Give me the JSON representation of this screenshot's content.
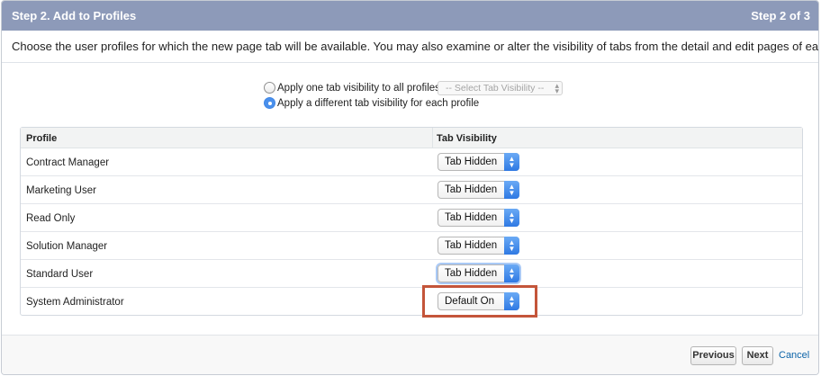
{
  "header": {
    "title": "Step 2. Add to Profiles",
    "step": "Step 2 of 3"
  },
  "intro": "Choose the user profiles for which the new page tab will be available. You may also examine or alter the visibility of tabs from the detail and edit pages of each profile.",
  "visibility_mode": {
    "option_all": {
      "label": "Apply one tab visibility to all profiles",
      "checked": false
    },
    "all_select_placeholder": "-- Select Tab Visibility --",
    "option_each": {
      "label": "Apply a different tab visibility for each profile",
      "checked": true
    }
  },
  "table": {
    "headers": {
      "profile": "Profile",
      "visibility": "Tab Visibility"
    },
    "rows": [
      {
        "profile": "Contract Manager",
        "visibility": "Tab Hidden"
      },
      {
        "profile": "Marketing User",
        "visibility": "Tab Hidden"
      },
      {
        "profile": "Read Only",
        "visibility": "Tab Hidden"
      },
      {
        "profile": "Solution Manager",
        "visibility": "Tab Hidden"
      },
      {
        "profile": "Standard User",
        "visibility": "Tab Hidden"
      },
      {
        "profile": "System Administrator",
        "visibility": "Default On"
      }
    ]
  },
  "footer": {
    "previous": "Previous",
    "next": "Next",
    "cancel": "Cancel"
  },
  "colors": {
    "header_bg": "#8d9ab9",
    "highlight": "#c4553a",
    "select_accent": "#3f86e6",
    "link": "#0b63a8"
  },
  "icons": {
    "select_chevron": "up-down-chevron-icon"
  }
}
